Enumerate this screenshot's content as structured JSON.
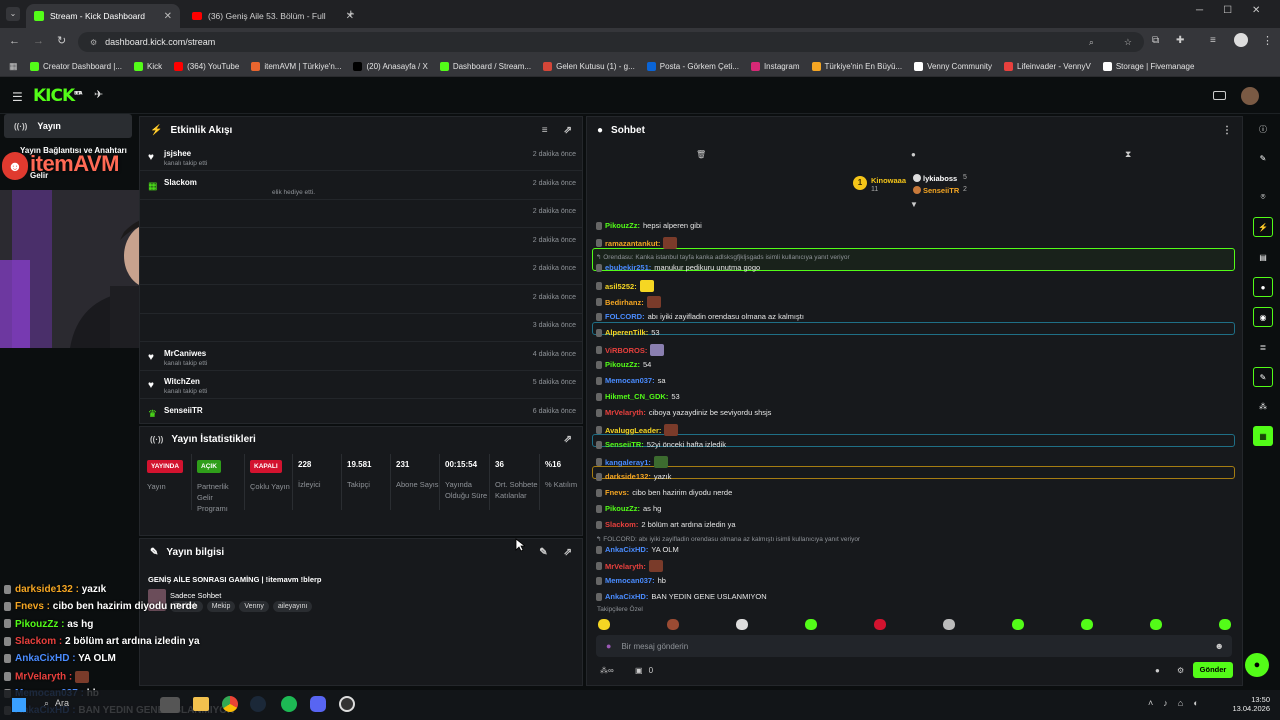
{
  "browser": {
    "tabs": [
      {
        "title": "Stream - Kick Dashboard",
        "active": true
      },
      {
        "title": "(36) Geniş Aile 53. Bölüm - Full",
        "active": false
      }
    ],
    "url": "dashboard.kick.com/stream",
    "bookmarks": [
      "Creator Dashboard |...",
      "Kick",
      "(364) YouTube",
      "itemAVM | Türkiye'n...",
      "(20) Anasayfa / X",
      "Dashboard / Stream...",
      "Gelen Kutusu (1) - g...",
      "Posta - Görkem Çeti...",
      "Instagram",
      "Türkiye'nin En Büyü...",
      "Venny Community",
      "Lifeinvader - VennyV",
      "Storage | Fivemanage"
    ]
  },
  "kick": {
    "logo": "KICK",
    "logo_sup": "BETA",
    "sidebar": {
      "active_item": "Yayın",
      "item2": "Yayın Bağlantısı ve Anahtarı",
      "item3": "Gelir",
      "sponsor": "itemAVM"
    },
    "activity": {
      "title": "Etkinlik Akışı",
      "rows": [
        {
          "name": "jsjshee",
          "sub": "kanalı takip etti",
          "time": "2 dakika önce",
          "icon": "heart-icon"
        },
        {
          "name": "Slackom",
          "sub": "elik hediye etti.",
          "time": "2 dakika önce",
          "icon": "gift-icon"
        },
        {
          "name": "",
          "sub": "",
          "time": "2 dakika önce",
          "icon": ""
        },
        {
          "name": "",
          "sub": "",
          "time": "2 dakika önce",
          "icon": ""
        },
        {
          "name": "",
          "sub": "",
          "time": "2 dakika önce",
          "icon": ""
        },
        {
          "name": "",
          "sub": "",
          "time": "2 dakika önce",
          "icon": ""
        },
        {
          "name": "",
          "sub": "",
          "time": "3 dakika önce",
          "icon": ""
        },
        {
          "name": "MrCaniwes",
          "sub": "kanalı takip etti",
          "time": "4 dakika önce",
          "icon": "heart-icon"
        },
        {
          "name": "WitchZen",
          "sub": "kanalı takip etti",
          "time": "5 dakika önce",
          "icon": "heart-icon"
        },
        {
          "name": "SenseiiTR",
          "sub": "",
          "time": "6 dakika önce",
          "icon": "sub-icon"
        }
      ]
    },
    "stats": {
      "title": "Yayın İstatistikleri",
      "items": [
        {
          "value": "YAYINDA",
          "label": "Yayın",
          "badge": "#d3132f"
        },
        {
          "value": "AÇIK",
          "label": "Partnerlik Gelir Programı",
          "badge": "#2f9e1a"
        },
        {
          "value": "KAPALI",
          "label": "Çoklu Yayın",
          "badge": "#d3132f"
        },
        {
          "value": "228",
          "label": "İzleyici"
        },
        {
          "value": "19.581",
          "label": "Takipçi"
        },
        {
          "value": "231",
          "label": "Abone Sayısı"
        },
        {
          "value": "00:15:54",
          "label": "Yayında Olduğu Süre"
        },
        {
          "value": "36",
          "label": "Ort. Sohbete Katılanlar"
        },
        {
          "value": "%16",
          "label": "% Katılım"
        }
      ]
    },
    "info": {
      "title": "Yayın bilgisi",
      "stream_title": "GENİŞ AİLE SONRASI GAMİNG | !itemavm !blerp",
      "category": "Sadece Sohbet",
      "tags": [
        "Turkish",
        "Mekip",
        "Venny",
        "aileyayını"
      ]
    },
    "chat": {
      "title": "Sohbet",
      "leaders": {
        "top": {
          "name": "Kinowaaa",
          "count": "11",
          "rank": "1"
        },
        "second": {
          "name": "lykiaboss",
          "count": "5"
        },
        "third": {
          "name": "SenseiiTR",
          "count": "2"
        }
      },
      "messages": [
        {
          "user": "PikouzZz",
          "color": "#53fc18",
          "text": "hepsi alperen gibi"
        },
        {
          "user": "ramazantankut",
          "color": "#f5a623",
          "text": ""
        },
        {
          "reply": "Orendasu: Kanka istanbul tayfa kanka adlsksgfjkljsgads isimli kullanıcıya yanıt veriyor",
          "user": "ebubekir251",
          "color": "#4a8cff",
          "text": "manukur pedikuru unutma gogo"
        },
        {
          "user": "asil5252",
          "color": "#f5d623",
          "text": ""
        },
        {
          "user": "Bedirhanz",
          "color": "#f5a623",
          "text": ""
        },
        {
          "user": "FOLCORD",
          "color": "#4a8cff",
          "text": "abı iyiki zayifladin orendasu olmana az kalmıştı"
        },
        {
          "user": "AlperenTilk",
          "color": "#f5d623",
          "text": "53"
        },
        {
          "user": "ViRBOROS",
          "color": "#e8403d",
          "text": ""
        },
        {
          "user": "PikouzZz",
          "color": "#53fc18",
          "text": "54"
        },
        {
          "user": "Memocan037",
          "color": "#4a8cff",
          "text": "sa"
        },
        {
          "user": "Hikmet_CN_GDK",
          "color": "#53fc18",
          "text": "53"
        },
        {
          "user": "MrVelaryth",
          "color": "#e8403d",
          "text": "ciboya yazaydiniz be seviyordu shsjs"
        },
        {
          "user": "AvaluggLeader",
          "color": "#f5d623",
          "text": ""
        },
        {
          "user": "SenseiiTR",
          "color": "#53fc18",
          "text": "52yi önceki hafta izledik"
        },
        {
          "user": "kangaleray1",
          "color": "#4a8cff",
          "text": ""
        },
        {
          "user": "darkside132",
          "color": "#f5a623",
          "text": "yazık"
        },
        {
          "user": "Fnevs",
          "color": "#f5a623",
          "text": "cibo ben hazirim diyodu nerde"
        },
        {
          "user": "PikouzZz",
          "color": "#53fc18",
          "text": "as hg"
        },
        {
          "user": "Slackom",
          "color": "#e8403d",
          "text": "2 bölüm art ardına izledin ya"
        },
        {
          "reply": "FOLCORD: abı iyiki zayifladin orendasu olmana az kalmıştı isimli kullanıcıya yanıt veriyor",
          "user": "AnkaCixHD",
          "color": "#4a8cff",
          "text": "YA OLM"
        },
        {
          "user": "MrVelaryth",
          "color": "#e8403d",
          "text": ""
        },
        {
          "user": "Memocan037",
          "color": "#4a8cff",
          "text": "hb"
        },
        {
          "user": "AnkaCixHD",
          "color": "#4a8cff",
          "text": "BAN YEDIN GENE USLANMIYON"
        }
      ],
      "followers_label": "Takipçilere Özel",
      "input_placeholder": "Bir mesaj gönderin",
      "send_label": "Gönder",
      "footer_count": "0"
    }
  },
  "overlay_chat": [
    {
      "user": "darkside132",
      "color": "#f5a623",
      "text": "yazık"
    },
    {
      "user": "Fnevs",
      "color": "#f5a623",
      "text": "cibo ben hazirim diyodu nerde"
    },
    {
      "user": "PikouzZz",
      "color": "#53fc18",
      "text": "as hg"
    },
    {
      "user": "Slackom",
      "color": "#e8403d",
      "text": "2 bölüm art ardına izledin ya"
    },
    {
      "user": "AnkaCixHD",
      "color": "#4a8cff",
      "text": "YA OLM"
    },
    {
      "user": "MrVelaryth",
      "color": "#e8403d",
      "text": ""
    },
    {
      "user": "Memocan037",
      "color": "#4a8cff",
      "text": "hb"
    },
    {
      "user": "AnkaCixHD",
      "color": "#4a8cff",
      "text": "BAN YEDIN GENE USLANMIYON"
    }
  ],
  "taskbar": {
    "search": "Ara",
    "time": "13:50",
    "date": "13.04.2026"
  }
}
